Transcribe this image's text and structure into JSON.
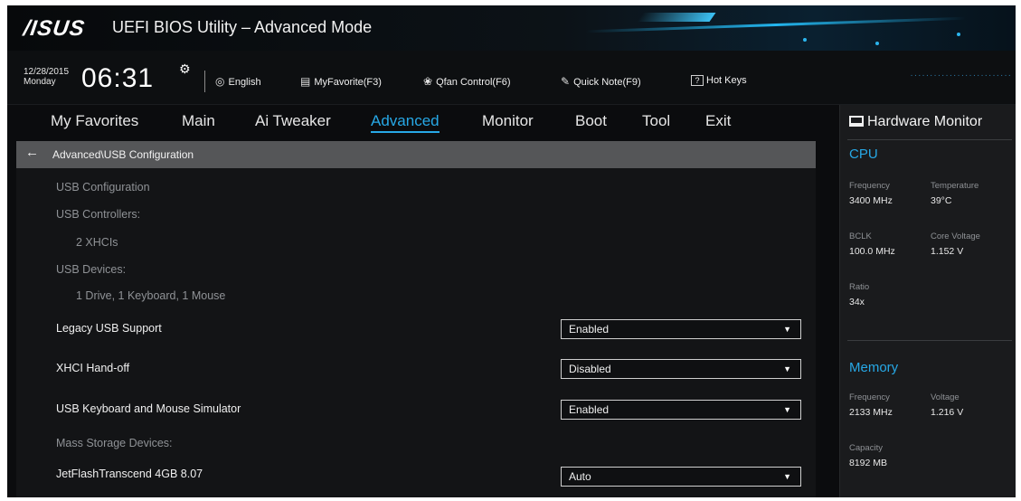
{
  "header": {
    "logo": "/ISUS",
    "title": "UEFI BIOS Utility – Advanced Mode"
  },
  "infobar": {
    "date": "12/28/2015",
    "day": "Monday",
    "time": "06:31",
    "tools": [
      {
        "icon": "globe-icon",
        "label": "English"
      },
      {
        "icon": "favorites-icon",
        "label": "MyFavorite(F3)"
      },
      {
        "icon": "fan-icon",
        "label": "Qfan Control(F6)"
      },
      {
        "icon": "note-icon",
        "label": "Quick Note(F9)"
      },
      {
        "icon": "help-icon",
        "label": "Hot Keys"
      }
    ],
    "hotkeys_glyph": "?"
  },
  "nav": {
    "items": [
      "My Favorites",
      "Main",
      "Ai Tweaker",
      "Advanced",
      "Monitor",
      "Boot",
      "Tool",
      "Exit"
    ],
    "active": "Advanced"
  },
  "breadcrumb": "Advanced\\USB Configuration",
  "content": {
    "usb_config_heading": "USB Configuration",
    "usb_controllers_label": "USB Controllers:",
    "usb_controllers_value": "2 XHCIs",
    "usb_devices_label": "USB Devices:",
    "usb_devices_value": "1 Drive, 1 Keyboard, 1 Mouse",
    "settings": [
      {
        "label": "Legacy USB Support",
        "value": "Enabled"
      },
      {
        "label": "XHCI Hand-off",
        "value": "Disabled"
      },
      {
        "label": "USB Keyboard and Mouse Simulator",
        "value": "Enabled"
      }
    ],
    "mass_storage_label": "Mass Storage Devices:",
    "mass_storage_devices": [
      {
        "label": "JetFlashTranscend 4GB 8.07",
        "value": "Auto"
      }
    ]
  },
  "hardware_monitor": {
    "title": "Hardware Monitor",
    "cpu": {
      "heading": "CPU",
      "frequency_label": "Frequency",
      "frequency": "3400 MHz",
      "temperature_label": "Temperature",
      "temperature": "39°C",
      "bclk_label": "BCLK",
      "bclk": "100.0 MHz",
      "core_voltage_label": "Core Voltage",
      "core_voltage": "1.152 V",
      "ratio_label": "Ratio",
      "ratio": "34x"
    },
    "memory": {
      "heading": "Memory",
      "frequency_label": "Frequency",
      "frequency": "2133 MHz",
      "voltage_label": "Voltage",
      "voltage": "1.216 V",
      "capacity_label": "Capacity",
      "capacity": "8192 MB"
    }
  },
  "colors": {
    "accent": "#27a8e6",
    "background": "#0b0c0e",
    "breadcrumb_bar": "#555658",
    "panel": "#1a1b1d"
  }
}
